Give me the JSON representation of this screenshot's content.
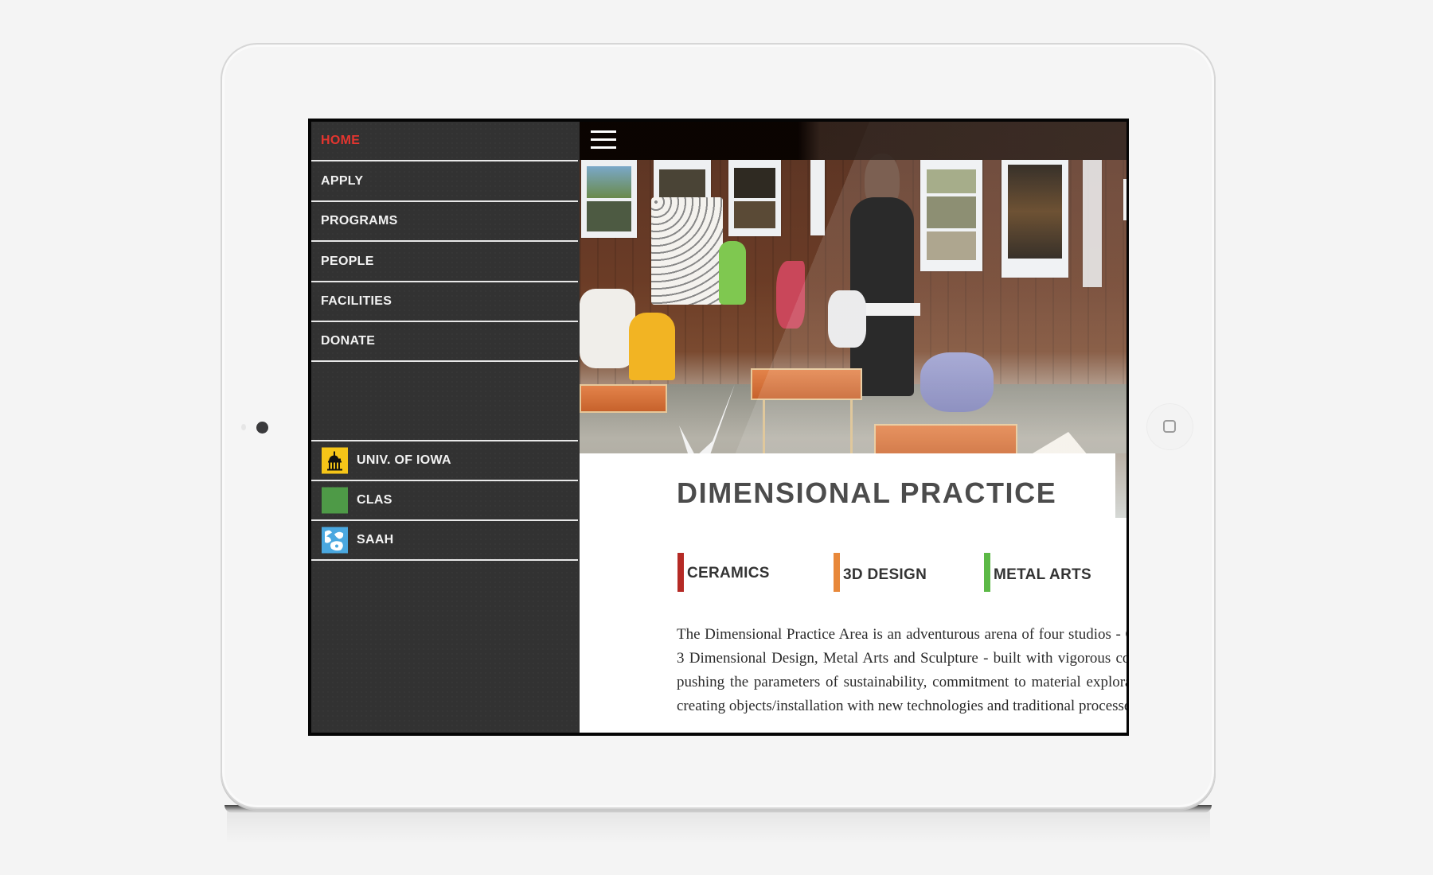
{
  "sidebar": {
    "nav_items": [
      {
        "label": "HOME",
        "active": true
      },
      {
        "label": "APPLY",
        "active": false
      },
      {
        "label": "PROGRAMS",
        "active": false
      },
      {
        "label": "PEOPLE",
        "active": false
      },
      {
        "label": "FACILITIES",
        "active": false
      },
      {
        "label": "DONATE",
        "active": false
      }
    ],
    "external_links": [
      {
        "label": "UNIV. OF IOWA",
        "icon": "university-dome-icon",
        "color": "#f5c518"
      },
      {
        "label": "CLAS",
        "icon": "clas-logo-icon",
        "color": "#4e9a47"
      },
      {
        "label": "SAAH",
        "icon": "saah-logo-icon",
        "color": "#4aa8e0"
      }
    ],
    "active_color": "#e4352f",
    "background": "#323232"
  },
  "topbar": {
    "menu_icon": "hamburger-menu-icon"
  },
  "hero": {
    "image_description": "Gallery exhibit of ceramic and 3D design sculptures on orange pedestals with a visitor viewing wall prints"
  },
  "main": {
    "title": "DIMENSIONAL PRACTICE",
    "categories": [
      {
        "label": "CERAMICS",
        "color": "#b52a25"
      },
      {
        "label": "3D DESIGN",
        "color": "#e8883a"
      },
      {
        "label": "METAL ARTS",
        "color": "#5cb946"
      }
    ],
    "body": "The Dimensional Practice Area is an adventurous arena of four studios - Ceramics, 3 Dimensional Design, Metal Arts and Sculpture - built with vigorous concepts of pushing the parameters of sustainability, commitment to material exploration, and creating objects/installation with new technologies and traditional processes."
  },
  "device": {
    "home_button_icon": "home-button-icon",
    "camera_icon": "camera-icon"
  }
}
